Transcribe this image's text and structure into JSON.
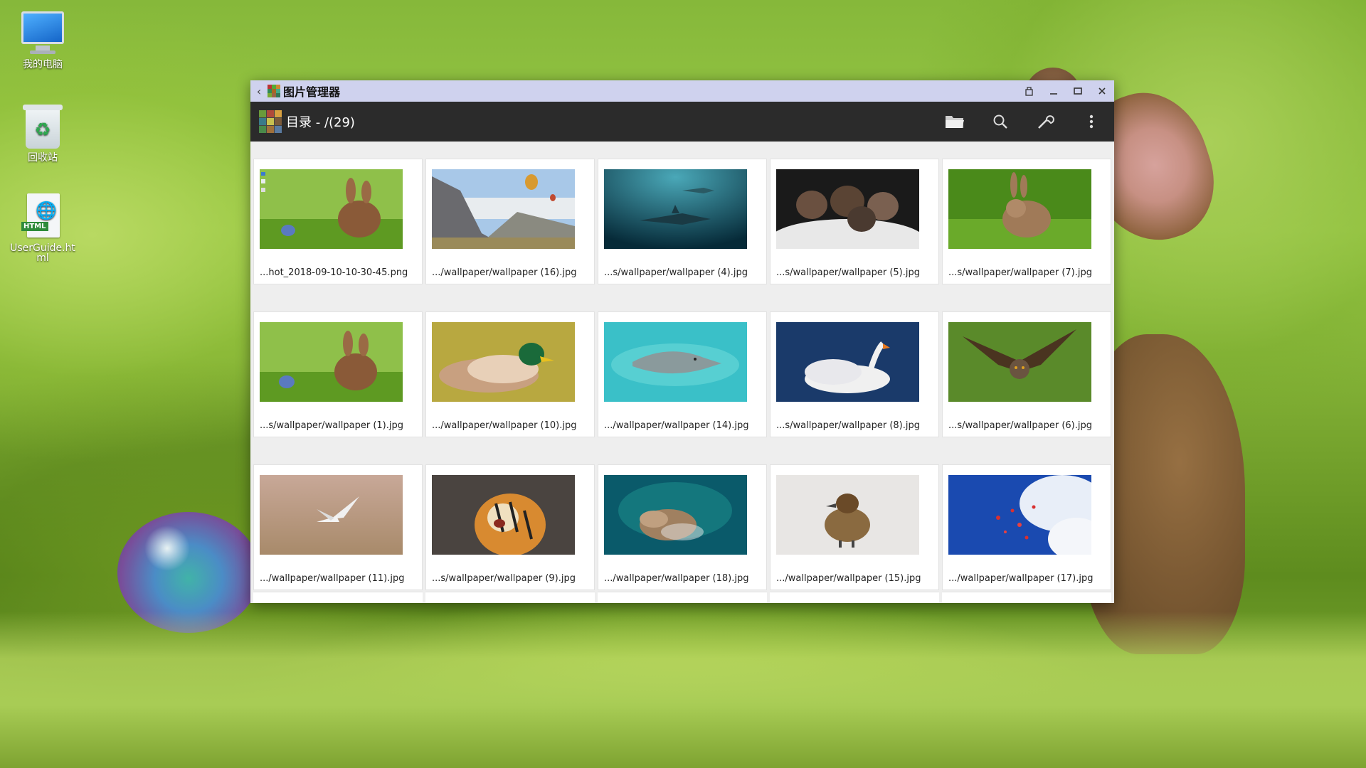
{
  "desktop": {
    "icons": [
      {
        "label": "我的电脑",
        "icon": "computer-icon"
      },
      {
        "label": "回收站",
        "icon": "recycle-bin-icon"
      },
      {
        "label": "UserGuide.html",
        "icon": "html-file-icon"
      }
    ]
  },
  "window": {
    "title": "图片管理器",
    "toolbar_title": "目录 - /(29)",
    "title_buttons": [
      "back-icon",
      "pin-icon",
      "minimize-icon",
      "maximize-icon",
      "close-icon"
    ],
    "toolbar_buttons": [
      "folder-icon",
      "search-icon",
      "wrench-icon",
      "more-vert-icon"
    ]
  },
  "images": [
    {
      "caption": "...hot_2018-09-10-10-30-45.png",
      "scene": "bunny-screenshot"
    },
    {
      "caption": ".../wallpaper/wallpaper (16).jpg",
      "scene": "mountain-balloons"
    },
    {
      "caption": "...s/wallpaper/wallpaper (4).jpg",
      "scene": "shark"
    },
    {
      "caption": "...s/wallpaper/wallpaper (5).jpg",
      "scene": "kittens"
    },
    {
      "caption": "...s/wallpaper/wallpaper (7).jpg",
      "scene": "rabbit"
    },
    {
      "caption": "...s/wallpaper/wallpaper (1).jpg",
      "scene": "bunny-egg"
    },
    {
      "caption": ".../wallpaper/wallpaper (10).jpg",
      "scene": "duck"
    },
    {
      "caption": ".../wallpaper/wallpaper (14).jpg",
      "scene": "dolphin"
    },
    {
      "caption": "...s/wallpaper/wallpaper (8).jpg",
      "scene": "swan"
    },
    {
      "caption": "...s/wallpaper/wallpaper (6).jpg",
      "scene": "owl"
    },
    {
      "caption": ".../wallpaper/wallpaper (11).jpg",
      "scene": "gull"
    },
    {
      "caption": "...s/wallpaper/wallpaper (9).jpg",
      "scene": "tiger"
    },
    {
      "caption": ".../wallpaper/wallpaper (18).jpg",
      "scene": "rocks-sea"
    },
    {
      "caption": ".../wallpaper/wallpaper (15).jpg",
      "scene": "duckling"
    },
    {
      "caption": ".../wallpaper/wallpaper (17).jpg",
      "scene": "sky-hearts"
    }
  ],
  "colors": {
    "titlebar": "#cfd2ee",
    "toolbar": "#2b2b2b",
    "content_bg": "#eeeeee"
  }
}
